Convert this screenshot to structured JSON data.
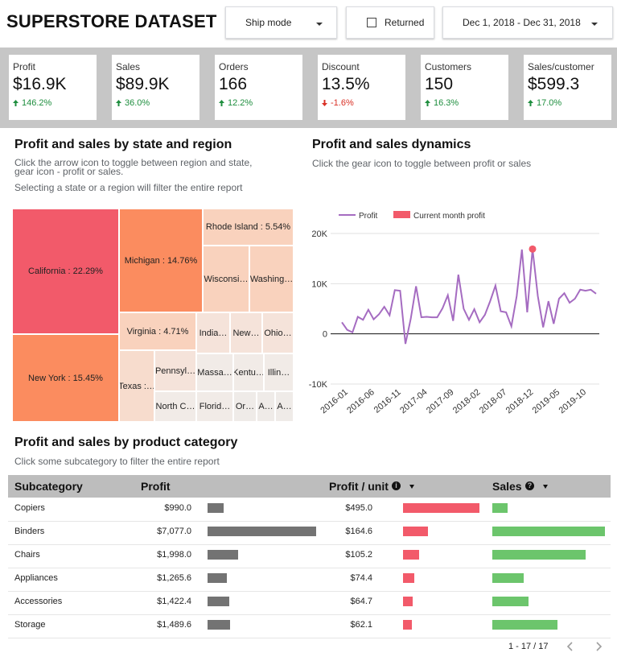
{
  "header": {
    "title": "SUPERSTORE DATASET",
    "ship_mode_label": "Ship mode",
    "returned_label": "Returned",
    "date_range_label": "Dec 1, 2018 - Dec 31, 2018"
  },
  "kpis": [
    {
      "label": "Profit",
      "value": "$16.9K",
      "change": "146.2%",
      "direction": "up"
    },
    {
      "label": "Sales",
      "value": "$89.9K",
      "change": "36.0%",
      "direction": "up"
    },
    {
      "label": "Orders",
      "value": "166",
      "change": "12.2%",
      "direction": "up"
    },
    {
      "label": "Discount",
      "value": "13.5%",
      "change": "-1.6%",
      "direction": "down"
    },
    {
      "label": "Customers",
      "value": "150",
      "change": "16.3%",
      "direction": "up"
    },
    {
      "label": "Sales/customer",
      "value": "$599.3",
      "change": "17.0%",
      "direction": "up"
    }
  ],
  "treemap_section": {
    "title": "Profit and sales by state and region",
    "subtitle1": "Click the arrow icon to toggle between region and state,",
    "subtitle2": "gear icon - profit or sales.",
    "subtitle3": "Selecting a state or a region will filter the entire report",
    "tiles": [
      {
        "label": "California : 22.29%",
        "color": "#f25a6a"
      },
      {
        "label": "New York : 15.45%",
        "color": "#fb8c5f"
      },
      {
        "label": "Michigan : 14.76%",
        "color": "#fb8c5f"
      },
      {
        "label": "Rhode Island : 5.54%",
        "color": "#f9d2bd"
      },
      {
        "label": "Wisconsi…",
        "color": "#f9d2bd"
      },
      {
        "label": "Washing…",
        "color": "#f9d2bd"
      },
      {
        "label": "Virginia : 4.71%",
        "color": "#f9d2bd"
      },
      {
        "label": "India…",
        "color": "#f5e3da"
      },
      {
        "label": "New…",
        "color": "#f5e3da"
      },
      {
        "label": "Ohio…",
        "color": "#f5e3da"
      },
      {
        "label": "Texas :…",
        "color": "#f7dccd"
      },
      {
        "label": "Pennsyl…",
        "color": "#f5e3da"
      },
      {
        "label": "Massa…",
        "color": "#f1ebe7"
      },
      {
        "label": "Kentu…",
        "color": "#f1ebe7"
      },
      {
        "label": "Illin…",
        "color": "#f1ebe7"
      },
      {
        "label": "North C…",
        "color": "#f1ebe7"
      },
      {
        "label": "Florid…",
        "color": "#f1ebe7"
      },
      {
        "label": "Or…",
        "color": "#efebe8"
      },
      {
        "label": "A…",
        "color": "#efebe8"
      },
      {
        "label": "A…",
        "color": "#efebe8"
      },
      {
        "label": "",
        "color": "#efebe8"
      }
    ]
  },
  "dynamics_section": {
    "title": "Profit and sales dynamics",
    "subtitle": "Click the gear icon to toggle between profit or sales"
  },
  "chart_data": {
    "type": "line",
    "legend": [
      {
        "name": "Profit",
        "color": "#a56cc1"
      },
      {
        "name": "Current month profit",
        "color": "#f25a6a"
      }
    ],
    "ylim": [
      -10000,
      20000
    ],
    "yticks": [
      "20K",
      "10K",
      "0",
      "-10K"
    ],
    "ytick_values": [
      20000,
      10000,
      0,
      -10000
    ],
    "xticks": [
      "2016-01",
      "2016-06",
      "2016-11",
      "2017-04",
      "2017-09",
      "2018-02",
      "2018-07",
      "2018-12",
      "2019-05",
      "2019-10"
    ],
    "series": [
      {
        "name": "Profit",
        "values": [
          2300,
          800,
          300,
          3400,
          2800,
          4800,
          2900,
          3900,
          5400,
          3700,
          8700,
          8600,
          -2000,
          3000,
          9500,
          3300,
          3400,
          3300,
          3300,
          5100,
          7700,
          2600,
          11800,
          5000,
          2800,
          4900,
          2300,
          3800,
          6500,
          9600,
          4500,
          4300,
          1500,
          7500,
          16800,
          4300,
          16900,
          7500,
          1300,
          6500,
          2000,
          7000,
          8100,
          6200,
          7000,
          8800,
          8600,
          8800,
          8000
        ]
      },
      {
        "name": "Current month profit",
        "points": [
          {
            "index": 36,
            "value": 16900
          }
        ]
      }
    ]
  },
  "category_section": {
    "title": "Profit and sales by product category",
    "subtitle": "Click some subcategory to filter the entire report"
  },
  "table": {
    "headers": {
      "subcategory": "Subcategory",
      "profit": "Profit",
      "profit_unit": "Profit / unit",
      "sales": "Sales"
    },
    "rows": [
      {
        "name": "Copiers",
        "profit": "$990.0",
        "profit_unit": "$495.0",
        "profit_frac": 0.145,
        "unit_frac": 1.0,
        "sales_frac": 0.135
      },
      {
        "name": "Binders",
        "profit": "$7,077.0",
        "profit_unit": "$164.6",
        "profit_frac": 1.0,
        "unit_frac": 0.33,
        "sales_frac": 1.0
      },
      {
        "name": "Chairs",
        "profit": "$1,998.0",
        "profit_unit": "$105.2",
        "profit_frac": 0.28,
        "unit_frac": 0.21,
        "sales_frac": 0.83
      },
      {
        "name": "Appliances",
        "profit": "$1,265.6",
        "profit_unit": "$74.4",
        "profit_frac": 0.18,
        "unit_frac": 0.15,
        "sales_frac": 0.28
      },
      {
        "name": "Accessories",
        "profit": "$1,422.4",
        "profit_unit": "$64.7",
        "profit_frac": 0.2,
        "unit_frac": 0.13,
        "sales_frac": 0.32
      },
      {
        "name": "Storage",
        "profit": "$1,489.6",
        "profit_unit": "$62.1",
        "profit_frac": 0.21,
        "unit_frac": 0.12,
        "sales_frac": 0.58
      }
    ],
    "pagination": "1 - 17 / 17"
  },
  "colors": {
    "profit_bar": "#737373",
    "unit_bar": "#f25a6a",
    "sales_bar": "#6cc56c",
    "line": "#a56cc1"
  }
}
